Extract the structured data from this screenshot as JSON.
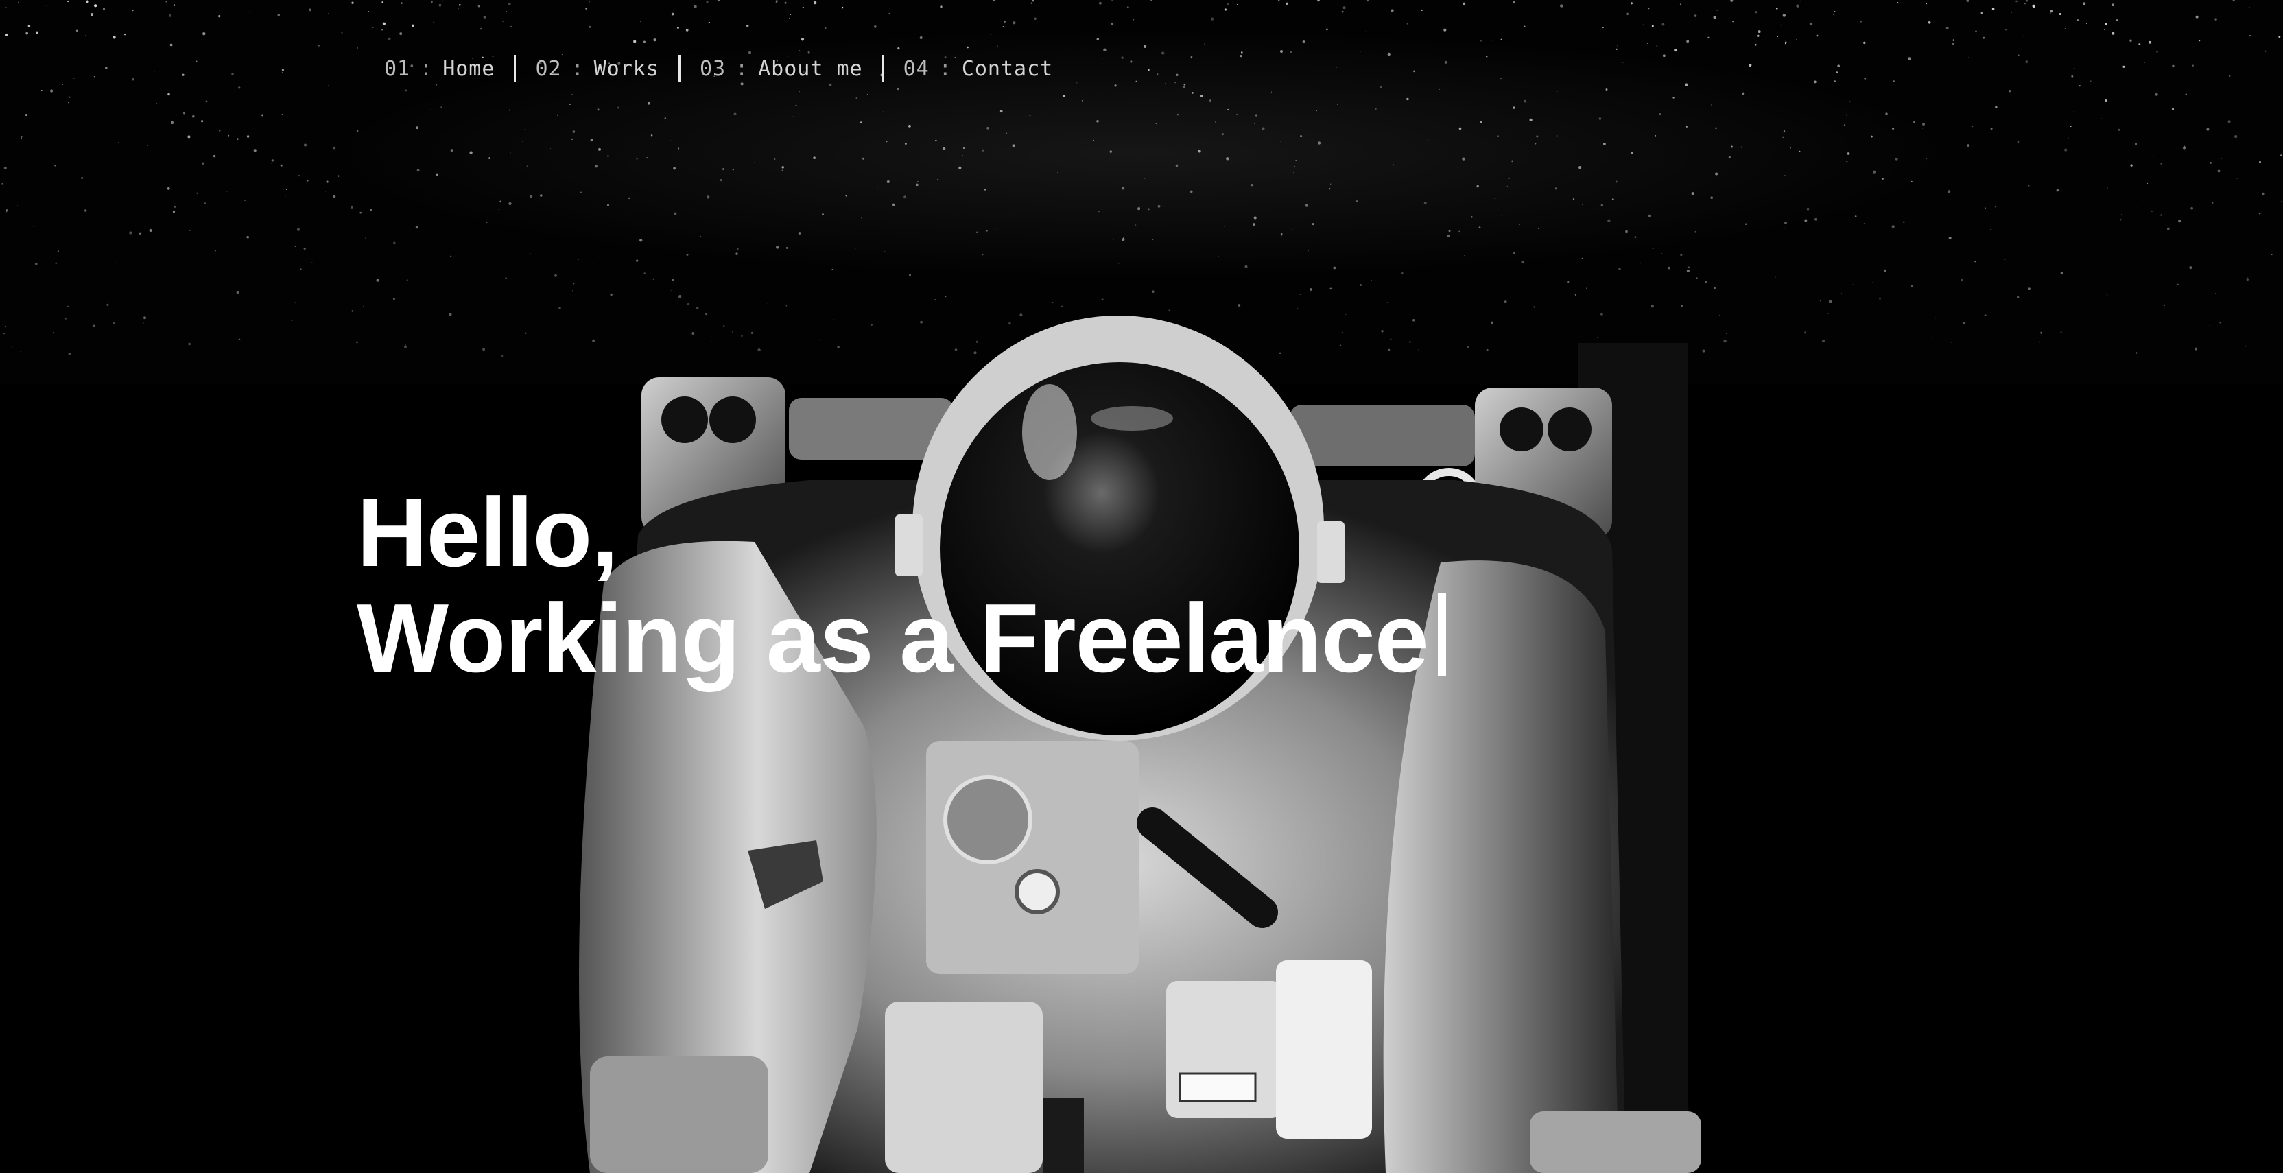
{
  "nav": {
    "items": [
      {
        "num": "01",
        "sep": ":",
        "label": "Home"
      },
      {
        "num": "02",
        "sep": ":",
        "label": "Works"
      },
      {
        "num": "03",
        "sep": ":",
        "label": "About me"
      },
      {
        "num": "04",
        "sep": ":",
        "label": "Contact"
      }
    ]
  },
  "hero": {
    "greeting": "Hello,",
    "tagline": "Working as a Freelance"
  },
  "background": {
    "subject": "astronaut-photo",
    "tone": "monochrome"
  }
}
